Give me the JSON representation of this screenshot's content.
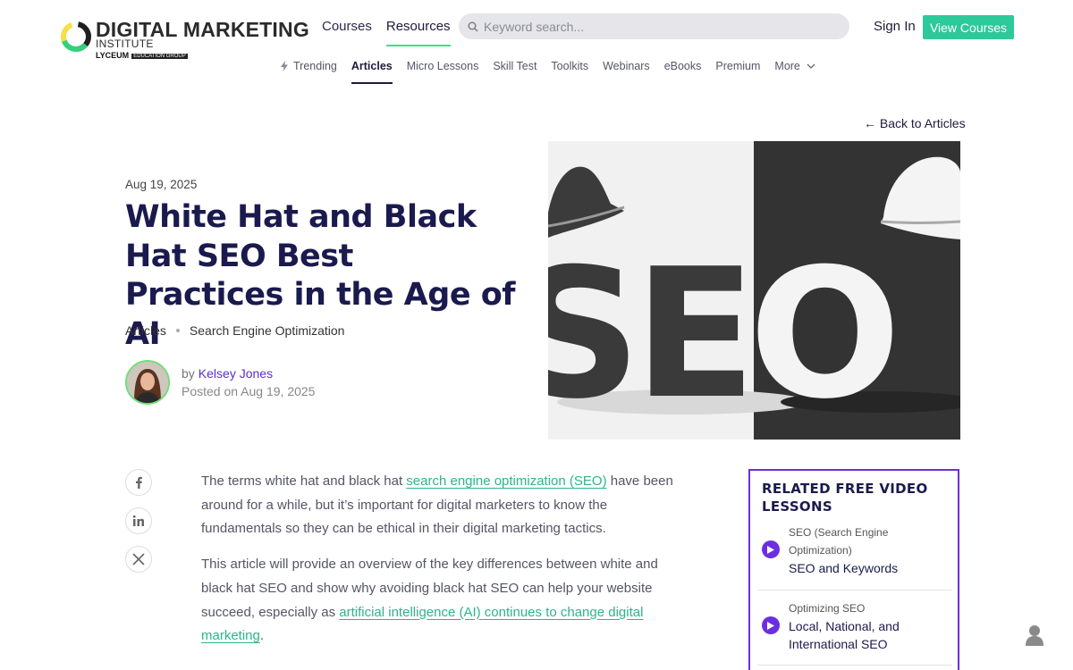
{
  "brand": {
    "title": "DIGITAL MARKETING",
    "subtitle": "INSTITUTE",
    "group": "LYCEUM",
    "group_tag": "EDUCATION GROUP",
    "accent": "#2cc99a"
  },
  "header": {
    "nav": [
      {
        "label": "Courses",
        "active": false
      },
      {
        "label": "Resources",
        "active": true
      }
    ],
    "search_placeholder": "Keyword search...",
    "sign_in": "Sign In",
    "view_courses": "View Courses"
  },
  "subnav": {
    "items": [
      {
        "label": "Trending",
        "icon": "lightning-icon"
      },
      {
        "label": "Articles",
        "active": true
      },
      {
        "label": "Micro Lessons"
      },
      {
        "label": "Skill Test"
      },
      {
        "label": "Toolkits"
      },
      {
        "label": "Webinars"
      },
      {
        "label": "eBooks"
      },
      {
        "label": "Premium"
      },
      {
        "label": "More",
        "icon": "chevron-down-icon"
      }
    ]
  },
  "article": {
    "back_link": "← Back to Articles",
    "date": "Aug 19, 2025",
    "title": "White Hat and Black Hat SEO Best Practices in the Age of AI",
    "categories": [
      "Articles",
      "Search Engine Optimization"
    ],
    "author_prefix": "by",
    "author": "Kelsey Jones",
    "posted": "Posted on Aug 19, 2025",
    "hero_text": "SEO",
    "p1_before": "The terms white hat and black hat ",
    "p1_link": "search engine optimization (SEO)",
    "p1_after": " have been around for a while, but it’s important for digital marketers to know the fundamentals so they can be ethical in their digital marketing tactics.",
    "p2_before": "This article will provide an overview of the key differences between white and black hat SEO and show why avoiding black hat SEO can help your website succeed, especially as ",
    "p2_link": "artificial intelligence (AI) continues to change digital marketing",
    "p2_after": "."
  },
  "share": [
    "facebook-icon",
    "linkedin-icon",
    "x-icon"
  ],
  "related": {
    "heading": "RELATED FREE VIDEO LESSONS",
    "accent": "#6b2fe0",
    "lessons": [
      {
        "category": "SEO (Search Engine Optimization)",
        "title": "SEO and Keywords"
      },
      {
        "category": "Optimizing SEO",
        "title": "Local, National, and International SEO"
      }
    ]
  }
}
